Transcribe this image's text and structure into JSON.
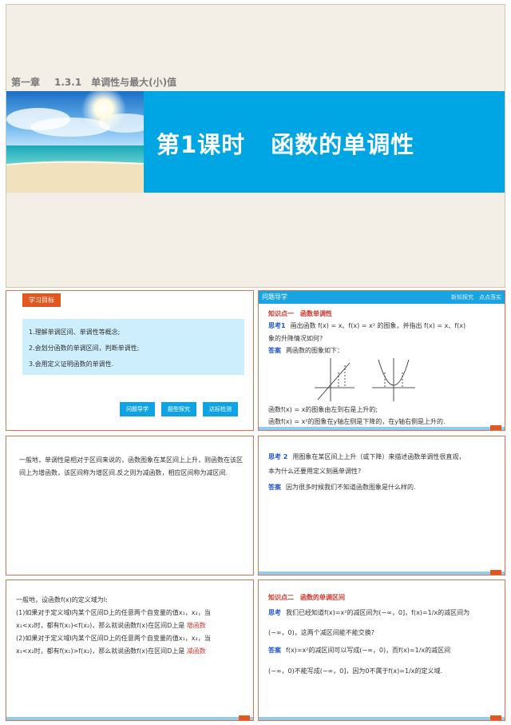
{
  "slide1": {
    "chapter": "第一章",
    "section": "1.3.1　单调性与最大(小)值",
    "lesson_a": "第1课时",
    "lesson_b": "函数的单调性"
  },
  "slide2": {
    "tag": "学习目标",
    "goals": [
      "1.理解单调区间、单调性等概念;",
      "2.会划分函数的单调区间，判断单调性;",
      "3.会用定义证明函数的单调性."
    ],
    "buttons": [
      "问题导学",
      "题型探究",
      "达标检测"
    ]
  },
  "slide3": {
    "header": "问题导学",
    "header_right": "新知探究　点点落实",
    "kp": "知识点一　函数单调性",
    "think_tag": "思考1",
    "think_text": "画出函数 f(x) = x、f(x) = x² 的图象，并指出 f(x) = x、f(x)",
    "think_text2": "象的升降情况如何?",
    "ans_tag": "答案",
    "ans_text": "两函数的图象如下：",
    "line1": "函数f(x) = x的图象由左到右是上升的;",
    "line2": "函数f(x) = x²的图象在y轴左侧是下降的，在y轴右侧是上升的."
  },
  "slide4": {
    "text": "一般地，单调性是相对于区间来说的，函数图象在某区间上上升，则函数在该区间上为增函数，该区间称为增区间.反之则为减函数，相应区间称为减区间."
  },
  "slide5": {
    "think_tag": "思考 2",
    "think_text": "用图象在某区间上上升（或下降）来描述函数单调性很直观，",
    "think_text2": "本为什么还要用定义刻画单调性?",
    "ans_tag": "答案",
    "ans_text": "因为很多时候我们不知道函数图象是什么样的."
  },
  "slide6": {
    "l1": "一般地，设函数f(x)的定义域为I:",
    "l2": "(1)如果对于定义域I内某个区间D上的任意两个自变量的值x₁，x₂，当",
    "l3": "x₁<x₂时，都有f(x₁)<f(x₂)，那么就说函数f(x)在区间D上是",
    "ans1": "增函数",
    "l4": "(2)如果对于定义域I内某个区间D上的任意两个自变量的值x₁，x₂，当",
    "l5": "x₁<x₂时，都有f(x₁)>f(x₂)，那么就说函数f(x)在区间D上是",
    "ans2": "减函数"
  },
  "slide7": {
    "kp": "知识点二　函数的单调区间",
    "think_tag": "思考",
    "think_text": "我们已经知道f(x)=x²的减区间为(−∞，0]，f(x)=1/x的减区间为",
    "think_text2": "(−∞，0)，这两个减区间能不能交换?",
    "ans_tag": "答案",
    "ans_text": "f(x)=x²的减区间可以写成(−∞，0)，而f(x)=1/x的减区间",
    "ans_text2": "(−∞，0)不能写成(−∞，0]，因为0不属于f(x)=1/x的定义域."
  },
  "colors": {
    "accent_blue": "#00a6e4",
    "accent_orange": "#e3561f",
    "accent_red": "#d0362b",
    "label_blue": "#1f56c9"
  }
}
